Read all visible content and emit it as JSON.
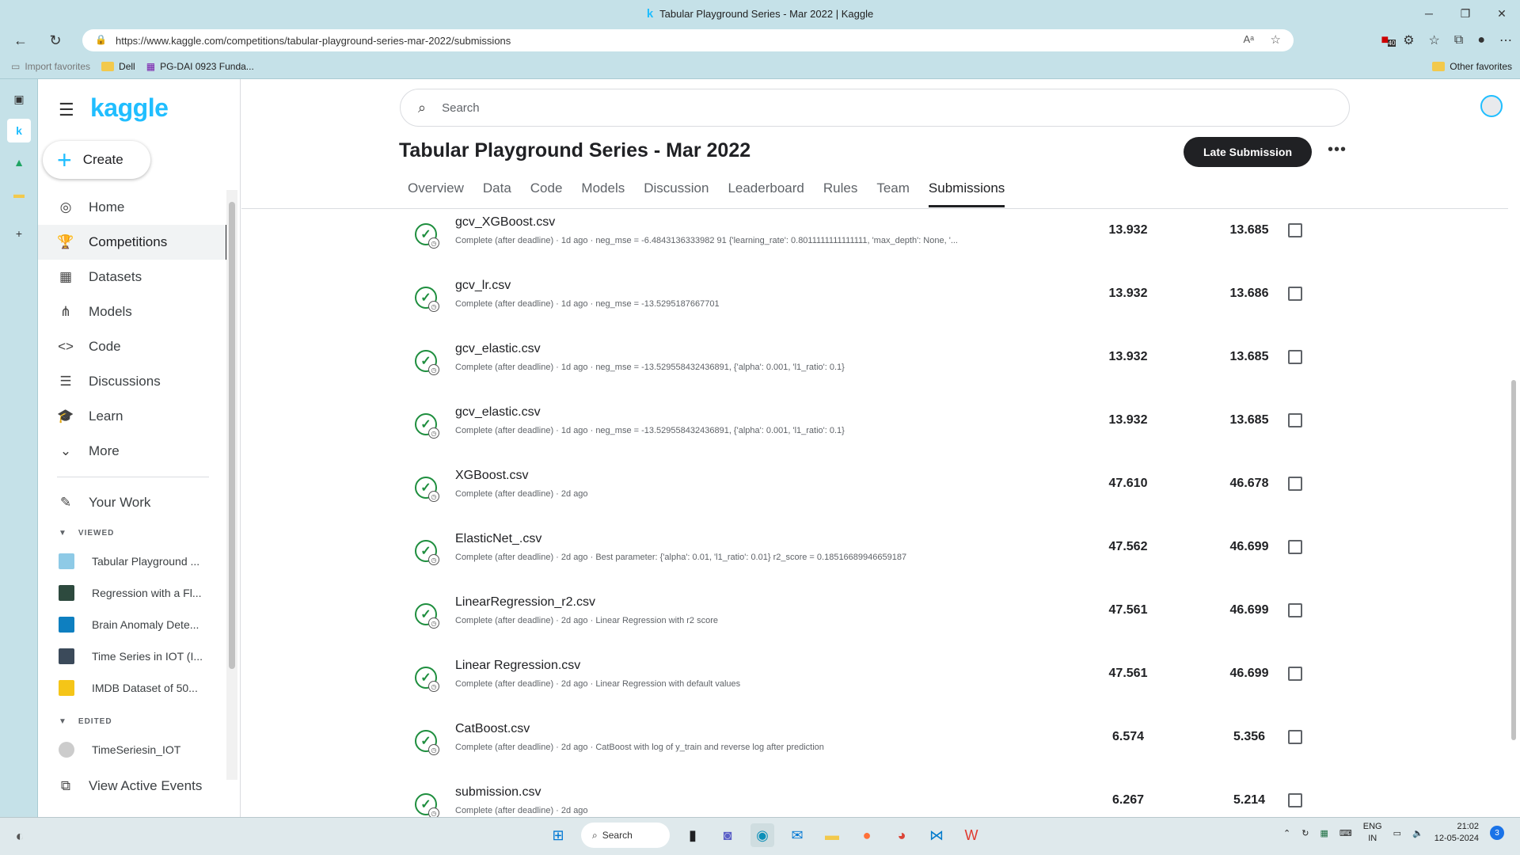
{
  "window": {
    "title": "Tabular Playground Series - Mar 2022 | Kaggle",
    "icon": "k"
  },
  "browser": {
    "url": "https://www.kaggle.com/competitions/tabular-playground-series-mar-2022/submissions",
    "favorites": [
      {
        "label": "Import favorites",
        "icon": "import-icon"
      },
      {
        "label": "Dell",
        "icon": "folder-icon"
      },
      {
        "label": "PG-DAI 0923 Funda...",
        "icon": "onenote-icon"
      }
    ],
    "other_favorites": "Other favorites",
    "extension_badge": "40"
  },
  "sidebar": {
    "logo": "kaggle",
    "create_label": "Create",
    "nav": [
      {
        "label": "Home",
        "icon": "compass-icon"
      },
      {
        "label": "Competitions",
        "icon": "trophy-icon",
        "active": true
      },
      {
        "label": "Datasets",
        "icon": "table-icon"
      },
      {
        "label": "Models",
        "icon": "models-icon"
      },
      {
        "label": "Code",
        "icon": "code-icon"
      },
      {
        "label": "Discussions",
        "icon": "discussion-icon"
      },
      {
        "label": "Learn",
        "icon": "learn-icon"
      },
      {
        "label": "More",
        "icon": "chevron-down-icon"
      }
    ],
    "your_work": "Your Work",
    "viewed_header": "VIEWED",
    "viewed": [
      {
        "label": "Tabular Playground ...",
        "color": "#8ecae6"
      },
      {
        "label": "Regression with a Fl...",
        "color": "#2d4a3e"
      },
      {
        "label": "Brain Anomaly Dete...",
        "color": "#0e7fc0"
      },
      {
        "label": "Time Series in IOT (I...",
        "color": "#3b4a5a"
      },
      {
        "label": "IMDB Dataset of 50...",
        "color": "#f5c518"
      }
    ],
    "edited_header": "EDITED",
    "edited": [
      {
        "label": "TimeSeriesin_IOT",
        "color": "#cccccc"
      }
    ],
    "view_active_events": "View Active Events"
  },
  "header": {
    "search_placeholder": "Search",
    "title": "Tabular Playground Series - Mar 2022",
    "late_submission": "Late Submission",
    "more": "•••",
    "tabs": [
      "Overview",
      "Data",
      "Code",
      "Models",
      "Discussion",
      "Leaderboard",
      "Rules",
      "Team",
      "Submissions"
    ],
    "active_tab": "Submissions"
  },
  "submissions": [
    {
      "file": "gcv_XGBoost.csv",
      "desc": "Complete (after deadline) · 1d ago · neg_mse = -6.4843136333982 91 {'learning_rate': 0.8011111111111111, 'max_depth': None, '...",
      "private": "13.932",
      "public": "13.685"
    },
    {
      "file": "gcv_lr.csv",
      "desc": "Complete (after deadline) · 1d ago · neg_mse = -13.5295187667701",
      "private": "13.932",
      "public": "13.686"
    },
    {
      "file": "gcv_elastic.csv",
      "desc": "Complete (after deadline) · 1d ago · neg_mse = -13.529558432436891, {'alpha': 0.001, 'l1_ratio': 0.1}",
      "private": "13.932",
      "public": "13.685"
    },
    {
      "file": "gcv_elastic.csv",
      "desc": "Complete (after deadline) · 1d ago · neg_mse = -13.529558432436891, {'alpha': 0.001, 'l1_ratio': 0.1}",
      "private": "13.932",
      "public": "13.685"
    },
    {
      "file": "XGBoost.csv",
      "desc": "Complete (after deadline) · 2d ago",
      "private": "47.610",
      "public": "46.678"
    },
    {
      "file": "ElasticNet_.csv",
      "desc": "Complete (after deadline) · 2d ago · Best parameter: {'alpha': 0.01, 'l1_ratio': 0.01} r2_score = 0.18516689946659187",
      "private": "47.562",
      "public": "46.699"
    },
    {
      "file": "LinearRegression_r2.csv",
      "desc": "Complete (after deadline) · 2d ago · Linear Regression with r2 score",
      "private": "47.561",
      "public": "46.699"
    },
    {
      "file": "Linear Regression.csv",
      "desc": "Complete (after deadline) · 2d ago · Linear Regression with default values",
      "private": "47.561",
      "public": "46.699"
    },
    {
      "file": "CatBoost.csv",
      "desc": "Complete (after deadline) · 2d ago · CatBoost with log of y_train and reverse log after prediction",
      "private": "6.574",
      "public": "5.356"
    },
    {
      "file": "submission.csv",
      "desc": "Complete (after deadline) · 2d ago",
      "private": "6.267",
      "public": "5.214"
    }
  ],
  "taskbar": {
    "search_label": "Search",
    "lang": "ENG",
    "region": "IN",
    "time": "21:02",
    "date": "12-05-2024",
    "notifications": "3"
  }
}
